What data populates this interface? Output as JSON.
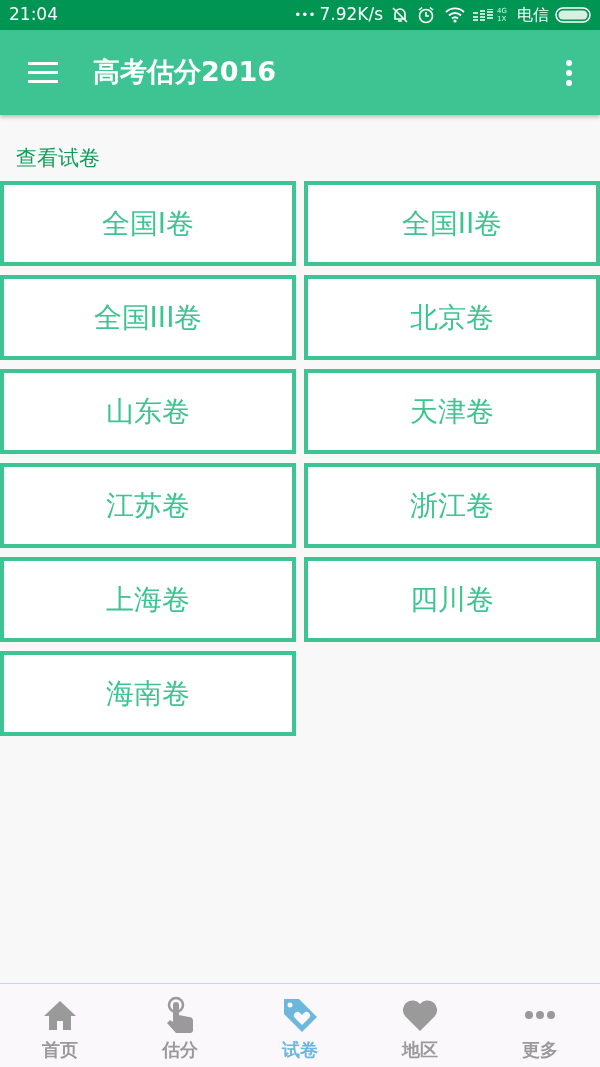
{
  "status_bar": {
    "time": "21:04",
    "dots": "•••",
    "speed": "7.92K/s",
    "network_top": "4G",
    "network_bottom": "1X",
    "carrier": "电信"
  },
  "app_bar": {
    "title": "高考估分2016"
  },
  "section": {
    "title": "查看试卷"
  },
  "papers": [
    {
      "label": "全国I卷"
    },
    {
      "label": "全国II卷"
    },
    {
      "label": "全国III卷"
    },
    {
      "label": "北京卷"
    },
    {
      "label": "山东卷"
    },
    {
      "label": "天津卷"
    },
    {
      "label": "江苏卷"
    },
    {
      "label": "浙江卷"
    },
    {
      "label": "上海卷"
    },
    {
      "label": "四川卷"
    },
    {
      "label": "海南卷"
    }
  ],
  "bottom_nav": [
    {
      "label": "首页",
      "kind": "home",
      "selected": false
    },
    {
      "label": "估分",
      "kind": "tap",
      "selected": false
    },
    {
      "label": "试卷",
      "kind": "tag",
      "selected": true
    },
    {
      "label": "地区",
      "kind": "heart",
      "selected": false
    },
    {
      "label": "更多",
      "kind": "more",
      "selected": false
    }
  ]
}
